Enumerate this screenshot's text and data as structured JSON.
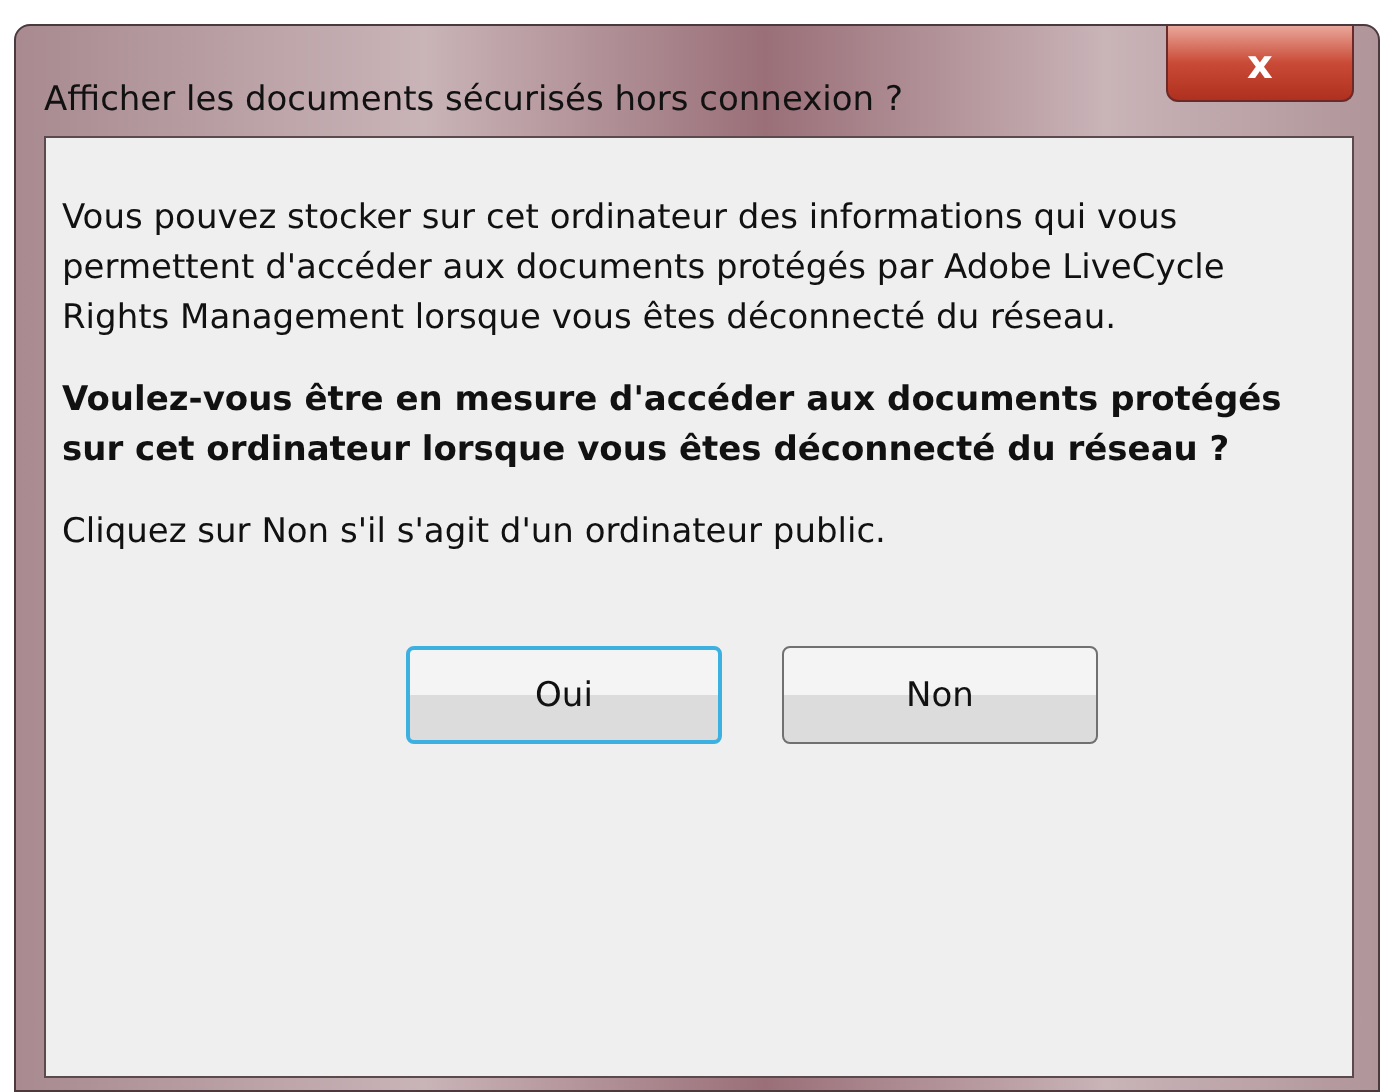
{
  "window": {
    "title": "Afficher les documents sécurisés hors connexion ?",
    "close": "x"
  },
  "message": "Vous pouvez stocker sur cet ordinateur des informations qui vous permettent d'accéder aux documents protégés par Adobe LiveCycle Rights Management lorsque vous êtes déconnecté du réseau.",
  "question": "Voulez-vous être en mesure d'accéder aux documents protégés sur cet ordinateur lorsque vous êtes déconnecté du réseau ?",
  "hint": "Cliquez sur Non s'il s'agit d'un ordinateur public.",
  "buttons": [
    {
      "label": "Oui",
      "default": true
    },
    {
      "label": "Non",
      "default": false
    }
  ]
}
